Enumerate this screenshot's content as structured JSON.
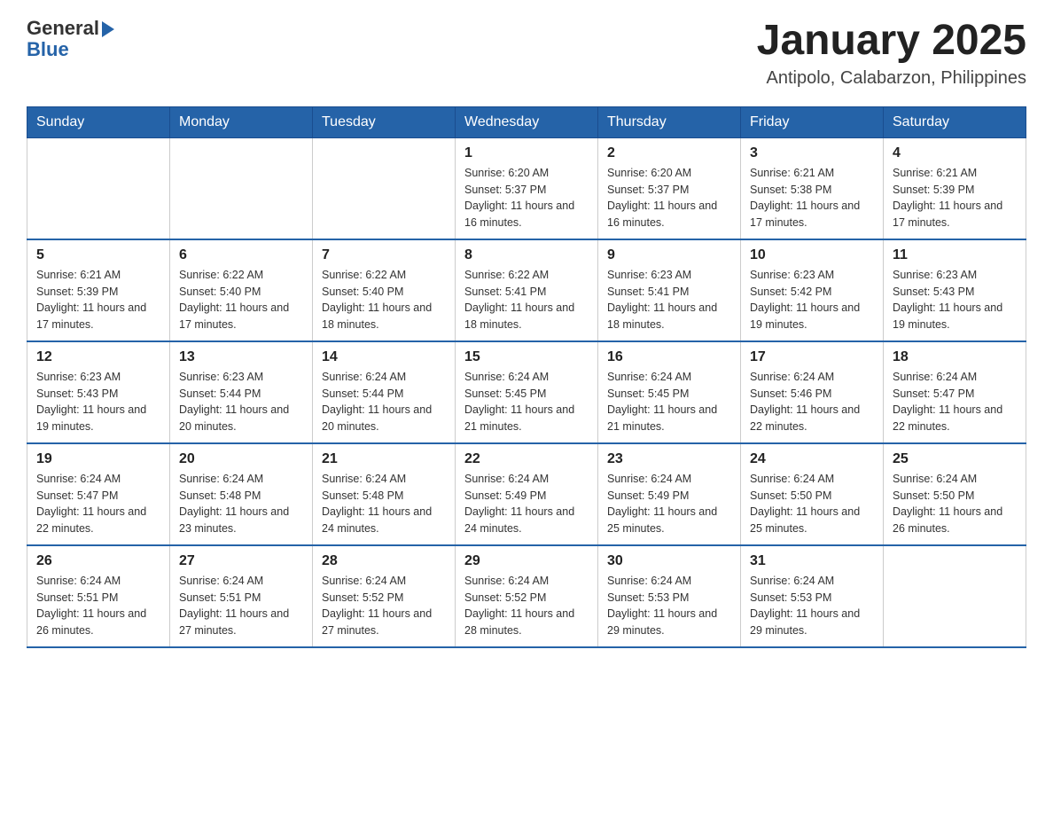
{
  "header": {
    "logo": {
      "general": "General",
      "arrow": "",
      "blue": "Blue"
    },
    "title": "January 2025",
    "subtitle": "Antipolo, Calabarzon, Philippines"
  },
  "calendar": {
    "days_of_week": [
      "Sunday",
      "Monday",
      "Tuesday",
      "Wednesday",
      "Thursday",
      "Friday",
      "Saturday"
    ],
    "weeks": [
      [
        {
          "day": "",
          "info": ""
        },
        {
          "day": "",
          "info": ""
        },
        {
          "day": "",
          "info": ""
        },
        {
          "day": "1",
          "info": "Sunrise: 6:20 AM\nSunset: 5:37 PM\nDaylight: 11 hours and 16 minutes."
        },
        {
          "day": "2",
          "info": "Sunrise: 6:20 AM\nSunset: 5:37 PM\nDaylight: 11 hours and 16 minutes."
        },
        {
          "day": "3",
          "info": "Sunrise: 6:21 AM\nSunset: 5:38 PM\nDaylight: 11 hours and 17 minutes."
        },
        {
          "day": "4",
          "info": "Sunrise: 6:21 AM\nSunset: 5:39 PM\nDaylight: 11 hours and 17 minutes."
        }
      ],
      [
        {
          "day": "5",
          "info": "Sunrise: 6:21 AM\nSunset: 5:39 PM\nDaylight: 11 hours and 17 minutes."
        },
        {
          "day": "6",
          "info": "Sunrise: 6:22 AM\nSunset: 5:40 PM\nDaylight: 11 hours and 17 minutes."
        },
        {
          "day": "7",
          "info": "Sunrise: 6:22 AM\nSunset: 5:40 PM\nDaylight: 11 hours and 18 minutes."
        },
        {
          "day": "8",
          "info": "Sunrise: 6:22 AM\nSunset: 5:41 PM\nDaylight: 11 hours and 18 minutes."
        },
        {
          "day": "9",
          "info": "Sunrise: 6:23 AM\nSunset: 5:41 PM\nDaylight: 11 hours and 18 minutes."
        },
        {
          "day": "10",
          "info": "Sunrise: 6:23 AM\nSunset: 5:42 PM\nDaylight: 11 hours and 19 minutes."
        },
        {
          "day": "11",
          "info": "Sunrise: 6:23 AM\nSunset: 5:43 PM\nDaylight: 11 hours and 19 minutes."
        }
      ],
      [
        {
          "day": "12",
          "info": "Sunrise: 6:23 AM\nSunset: 5:43 PM\nDaylight: 11 hours and 19 minutes."
        },
        {
          "day": "13",
          "info": "Sunrise: 6:23 AM\nSunset: 5:44 PM\nDaylight: 11 hours and 20 minutes."
        },
        {
          "day": "14",
          "info": "Sunrise: 6:24 AM\nSunset: 5:44 PM\nDaylight: 11 hours and 20 minutes."
        },
        {
          "day": "15",
          "info": "Sunrise: 6:24 AM\nSunset: 5:45 PM\nDaylight: 11 hours and 21 minutes."
        },
        {
          "day": "16",
          "info": "Sunrise: 6:24 AM\nSunset: 5:45 PM\nDaylight: 11 hours and 21 minutes."
        },
        {
          "day": "17",
          "info": "Sunrise: 6:24 AM\nSunset: 5:46 PM\nDaylight: 11 hours and 22 minutes."
        },
        {
          "day": "18",
          "info": "Sunrise: 6:24 AM\nSunset: 5:47 PM\nDaylight: 11 hours and 22 minutes."
        }
      ],
      [
        {
          "day": "19",
          "info": "Sunrise: 6:24 AM\nSunset: 5:47 PM\nDaylight: 11 hours and 22 minutes."
        },
        {
          "day": "20",
          "info": "Sunrise: 6:24 AM\nSunset: 5:48 PM\nDaylight: 11 hours and 23 minutes."
        },
        {
          "day": "21",
          "info": "Sunrise: 6:24 AM\nSunset: 5:48 PM\nDaylight: 11 hours and 24 minutes."
        },
        {
          "day": "22",
          "info": "Sunrise: 6:24 AM\nSunset: 5:49 PM\nDaylight: 11 hours and 24 minutes."
        },
        {
          "day": "23",
          "info": "Sunrise: 6:24 AM\nSunset: 5:49 PM\nDaylight: 11 hours and 25 minutes."
        },
        {
          "day": "24",
          "info": "Sunrise: 6:24 AM\nSunset: 5:50 PM\nDaylight: 11 hours and 25 minutes."
        },
        {
          "day": "25",
          "info": "Sunrise: 6:24 AM\nSunset: 5:50 PM\nDaylight: 11 hours and 26 minutes."
        }
      ],
      [
        {
          "day": "26",
          "info": "Sunrise: 6:24 AM\nSunset: 5:51 PM\nDaylight: 11 hours and 26 minutes."
        },
        {
          "day": "27",
          "info": "Sunrise: 6:24 AM\nSunset: 5:51 PM\nDaylight: 11 hours and 27 minutes."
        },
        {
          "day": "28",
          "info": "Sunrise: 6:24 AM\nSunset: 5:52 PM\nDaylight: 11 hours and 27 minutes."
        },
        {
          "day": "29",
          "info": "Sunrise: 6:24 AM\nSunset: 5:52 PM\nDaylight: 11 hours and 28 minutes."
        },
        {
          "day": "30",
          "info": "Sunrise: 6:24 AM\nSunset: 5:53 PM\nDaylight: 11 hours and 29 minutes."
        },
        {
          "day": "31",
          "info": "Sunrise: 6:24 AM\nSunset: 5:53 PM\nDaylight: 11 hours and 29 minutes."
        },
        {
          "day": "",
          "info": ""
        }
      ]
    ]
  }
}
